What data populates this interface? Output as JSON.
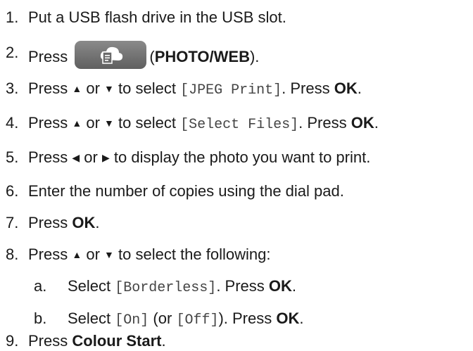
{
  "steps": [
    {
      "num": "1.",
      "parts": {
        "t1": "Put a USB flash drive in the USB slot."
      }
    },
    {
      "num": "2.",
      "parts": {
        "t1": "Press",
        "t2": "(",
        "b1": "PHOTO/WEB",
        "t3": ")."
      }
    },
    {
      "num": "3.",
      "parts": {
        "t1": "Press",
        "t2": "or",
        "t3": "to select",
        "m1": "[JPEG Print]",
        "t4": ". Press",
        "b1": "OK",
        "t5": "."
      }
    },
    {
      "num": "4.",
      "parts": {
        "t1": "Press",
        "t2": "or",
        "t3": "to select",
        "m1": "[Select Files]",
        "t4": ". Press",
        "b1": "OK",
        "t5": "."
      }
    },
    {
      "num": "5.",
      "parts": {
        "t1": "Press",
        "t2": "or",
        "t3": "to display the photo you want to print."
      }
    },
    {
      "num": "6.",
      "parts": {
        "t1": "Enter the number of copies using the dial pad."
      }
    },
    {
      "num": "7.",
      "parts": {
        "t1": "Press",
        "b1": "OK",
        "t2": "."
      }
    },
    {
      "num": "8.",
      "parts": {
        "t1": "Press",
        "t2": "or",
        "t3": "to select the following:"
      }
    },
    {
      "num": "9.",
      "parts": {
        "t1": "Press",
        "b1": "Colour Start",
        "t2": "."
      }
    }
  ],
  "substeps": [
    {
      "num": "a.",
      "parts": {
        "t1": "Select",
        "m1": "[Borderless]",
        "t2": ". Press",
        "b1": "OK",
        "t3": "."
      }
    },
    {
      "num": "b.",
      "parts": {
        "t1": "Select",
        "m1": "[On]",
        "t2": "(or",
        "m2": "[Off]",
        "t3": "). Press",
        "b1": "OK",
        "t4": "."
      }
    }
  ],
  "glyphs": {
    "up": "▲",
    "down": "▼",
    "left": "◀",
    "right": "▶"
  },
  "icons": {
    "photo_web_button": "cloud-document-icon"
  }
}
